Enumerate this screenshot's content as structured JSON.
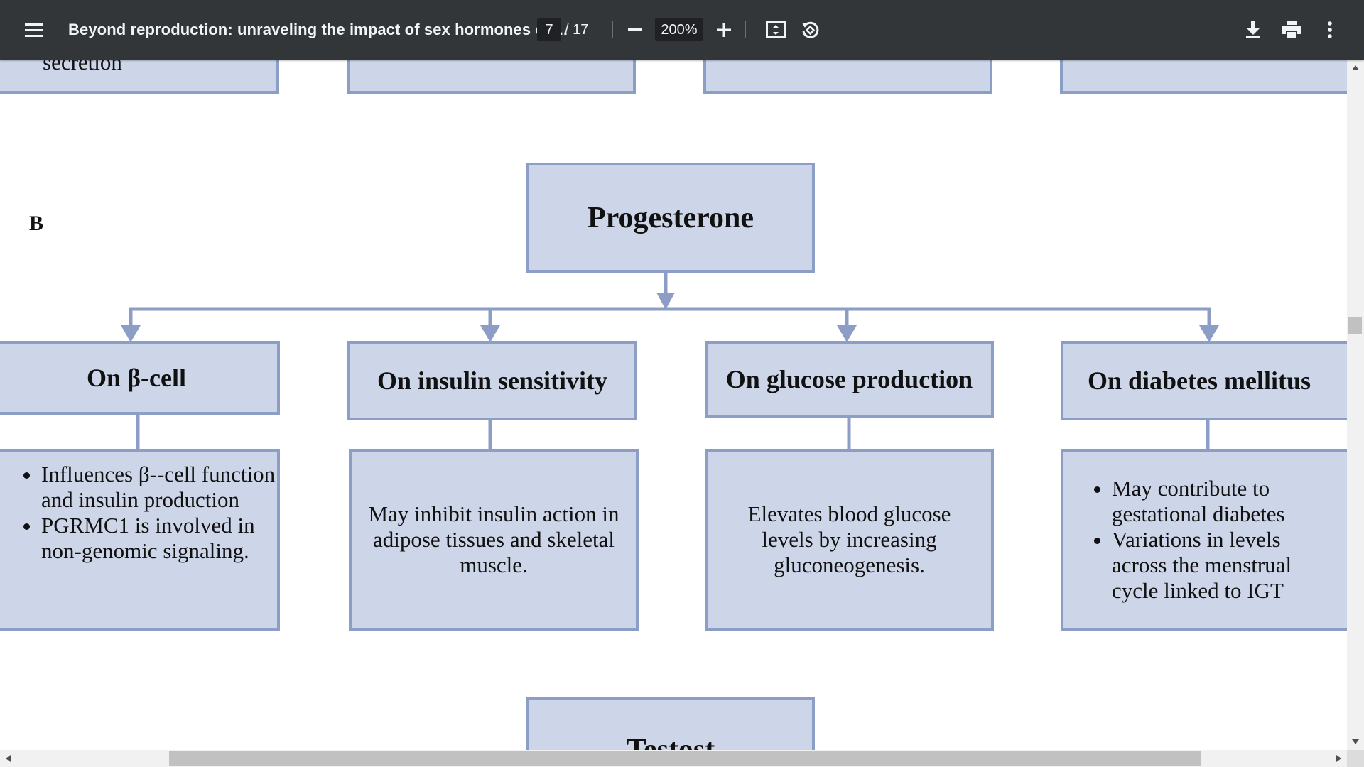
{
  "toolbar": {
    "menu_icon": "hamburger-menu-icon",
    "title": "Beyond reproduction: unraveling the impact of sex hormones on...",
    "current_page": "7",
    "total_pages": "/ 17",
    "zoom": "200%",
    "icons": {
      "zoom_out": "minus-icon",
      "zoom_in": "plus-icon",
      "fit": "fit-to-page-icon",
      "rotate": "rotate-icon",
      "download": "download-icon",
      "print": "print-icon",
      "more": "more-vert-icon"
    }
  },
  "document": {
    "partial_top_text": "secretion",
    "panel_letter": "B",
    "root_box": "Progesterone",
    "categories": [
      {
        "title": "On β-cell",
        "bullets": [
          "Influences β--cell function and insulin production",
          "PGRMC1 is involved in non-genomic signaling."
        ]
      },
      {
        "title": "On insulin sensitivity",
        "text": "May inhibit insulin action in adipose tissues and skeletal muscle."
      },
      {
        "title": "On glucose production",
        "text": "Elevates blood glucose levels by increasing gluconeogenesis."
      },
      {
        "title": "On diabetes mellitus",
        "bullets": [
          "May contribute to gestational diabetes",
          " Variations in levels across the menstrual cycle linked to IGT"
        ]
      }
    ],
    "next_box_partial": "Testost"
  },
  "colors": {
    "toolbar_bg": "#323639",
    "box_fill": "#cdd5e8",
    "box_border": "#8c9dc6",
    "connector": "#8c9dc6"
  }
}
